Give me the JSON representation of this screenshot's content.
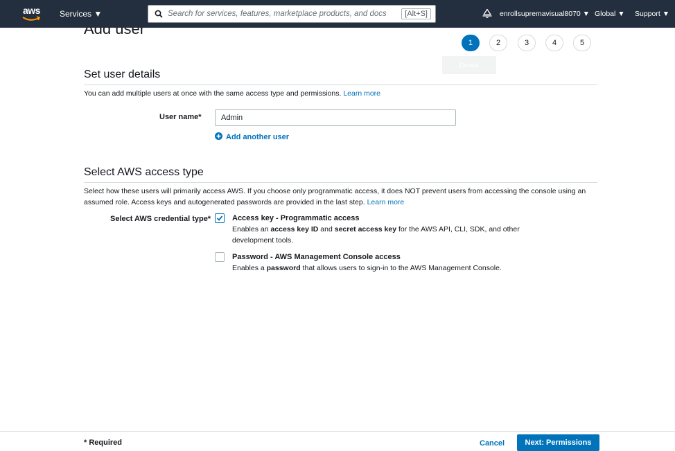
{
  "topnav": {
    "logo_text": "aws",
    "services_label": "Services ▼",
    "search_placeholder": "Search for services, features, marketplace products, and docs",
    "search_shortcut": "[Alt+S]",
    "account_label": "enrollsupremavisual8070 ▼",
    "region_label": "Global ▼",
    "support_label": "Support ▼"
  },
  "page": {
    "title": "Add user"
  },
  "steps": {
    "items": [
      "1",
      "2",
      "3",
      "4",
      "5"
    ],
    "active": "1",
    "tooltip": "Details"
  },
  "user_details": {
    "title": "Set user details",
    "description": "You can add multiple users at once with the same access type and permissions.",
    "learn_more": "Learn more",
    "username_label": "User name*",
    "username_value": "Admin",
    "add_another": "Add another user"
  },
  "access_type": {
    "title": "Select AWS access type",
    "description": "Select how these users will primarily access AWS. If you choose only programmatic access, it does NOT prevent users from accessing the console using an assumed role. Access keys and autogenerated passwords are provided in the last step.",
    "learn_more": "Learn more",
    "credential_label": "Select AWS credential type*",
    "options": [
      {
        "title": "Access key - Programmatic access",
        "desc_pre": "Enables an ",
        "desc_b1": "access key ID",
        "desc_mid": " and ",
        "desc_b2": "secret access key",
        "desc_post": " for the AWS API, CLI, SDK, and other development tools.",
        "checked": true
      },
      {
        "title": "Password - AWS Management Console access",
        "desc_pre": "Enables a ",
        "desc_b1": "password",
        "desc_post": " that allows users to sign-in to the AWS Management Console.",
        "checked": false
      }
    ]
  },
  "footer": {
    "required": "* Required",
    "cancel": "Cancel",
    "next": "Next: Permissions"
  },
  "colors": {
    "nav_bg": "#232f3e",
    "accent": "#0073bb"
  }
}
